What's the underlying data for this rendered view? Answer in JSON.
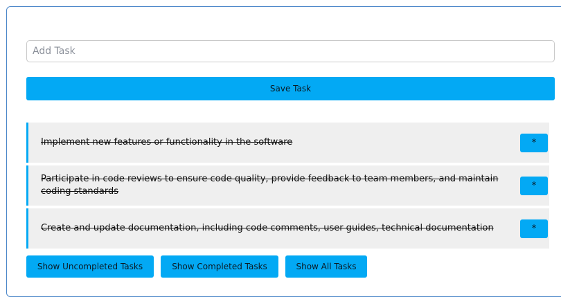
{
  "add_task": {
    "placeholder": "Add Task",
    "value": ""
  },
  "save_button": {
    "label": "Save Task"
  },
  "tasks": [
    {
      "text": "Implement new features or functionality in the software",
      "completed": true,
      "delete_icon": "asterisk-icon",
      "delete_glyph": "*"
    },
    {
      "text": "Participate in code reviews to ensure code quality, provide feedback to team members, and maintain coding standards",
      "completed": true,
      "delete_icon": "asterisk-icon",
      "delete_glyph": "*"
    },
    {
      "text": "Create and update documentation, including code comments, user guides, technical documentation",
      "completed": true,
      "delete_icon": "asterisk-icon",
      "delete_glyph": "*"
    }
  ],
  "filters": {
    "uncompleted_label": "Show Uncompleted Tasks",
    "completed_label": "Show Completed Tasks",
    "all_label": "Show All Tasks"
  },
  "colors": {
    "accent": "#03a9f4",
    "task_background": "#efefef",
    "frame_border": "#4a86c8"
  }
}
